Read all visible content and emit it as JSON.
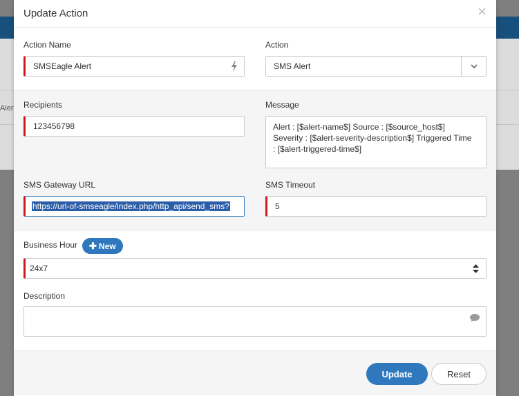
{
  "background": {
    "partial_text": "Alert"
  },
  "modal": {
    "title": "Update Action",
    "close_symbol": "×"
  },
  "form": {
    "action_name": {
      "label": "Action Name",
      "value": "SMSEagle Alert",
      "icon": "bolt-icon"
    },
    "action": {
      "label": "Action",
      "value": "SMS Alert",
      "icon": "chevron-down-icon"
    },
    "recipients": {
      "label": "Recipients",
      "value": "123456798"
    },
    "message": {
      "label": "Message",
      "lines": [
        "Alert : [$alert-name$]  Source : [$source_host$]",
        "Severity : [$alert-severity-description$]  Triggered Time",
        ": [$alert-triggered-time$]"
      ]
    },
    "gateway_url": {
      "label": "SMS Gateway URL",
      "value": "https://url-of-smseagle/index.php/http_api/send_sms?"
    },
    "timeout": {
      "label": "SMS Timeout",
      "value": "5"
    },
    "business_hour": {
      "label": "Business Hour",
      "new_label": "New",
      "new_icon": "plus-icon",
      "value": "24x7",
      "icon": "up-down-icon"
    },
    "description": {
      "label": "Description",
      "value": "",
      "icon": "comment-icon"
    }
  },
  "footer": {
    "update_label": "Update",
    "reset_label": "Reset"
  },
  "colors": {
    "primary": "#2f78bd",
    "required": "#d0181c",
    "header_band": "#17507d"
  }
}
